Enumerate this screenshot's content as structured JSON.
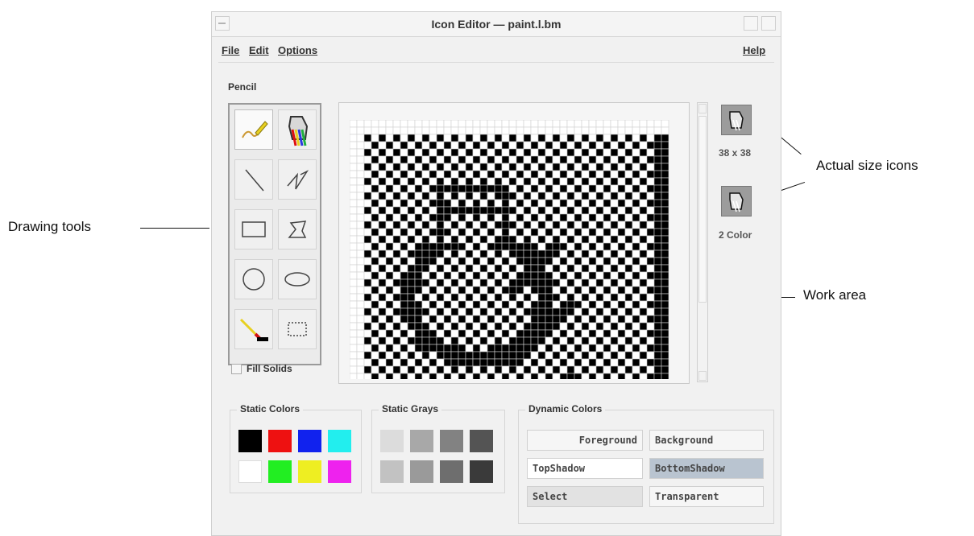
{
  "window": {
    "title": "Icon Editor — paint.l.bm"
  },
  "menu": {
    "file": "File",
    "edit": "Edit",
    "options": "Options",
    "help": "Help"
  },
  "current_tool": "Pencil",
  "tools": [
    {
      "name": "pencil",
      "icon": "pencil-icon"
    },
    {
      "name": "flood-fill",
      "icon": "paint-bucket-icon"
    },
    {
      "name": "line",
      "icon": "line-icon"
    },
    {
      "name": "polyline",
      "icon": "polyline-icon"
    },
    {
      "name": "rectangle",
      "icon": "rectangle-icon"
    },
    {
      "name": "polygon",
      "icon": "polygon-icon"
    },
    {
      "name": "circle",
      "icon": "circle-icon"
    },
    {
      "name": "ellipse",
      "icon": "ellipse-icon"
    },
    {
      "name": "eraser",
      "icon": "eraser-icon"
    },
    {
      "name": "select",
      "icon": "select-box-icon"
    }
  ],
  "fill_solids": {
    "label": "Fill Solids",
    "checked": false
  },
  "actual_size": {
    "size_label": "38 x 38",
    "color_label": "2 Color"
  },
  "static_colors": {
    "title": "Static Colors",
    "swatches": [
      "#000000",
      "#ee1111",
      "#1122ee",
      "#22eeee",
      "#ffffff",
      "#22ee22",
      "#eeee22",
      "#ee22ee"
    ]
  },
  "static_grays": {
    "title": "Static Grays",
    "swatches": [
      "#dcdcdc",
      "#a8a8a8",
      "#828282",
      "#545454",
      "#c2c2c2",
      "#9a9a9a",
      "#6e6e6e",
      "#3a3a3a"
    ]
  },
  "dynamic_colors": {
    "title": "Dynamic Colors",
    "buttons": [
      "Foreground",
      "Background",
      "TopShadow",
      "BottomShadow",
      "Select",
      "Transparent"
    ]
  },
  "annotations": {
    "drawing_tools": "Drawing tools",
    "actual_size_icons": "Actual size icons",
    "work_area": "Work area"
  }
}
